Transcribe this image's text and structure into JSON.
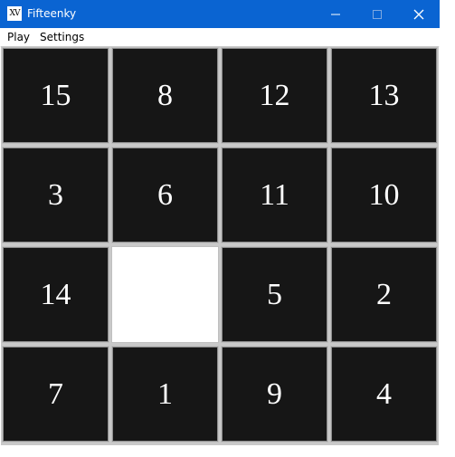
{
  "window": {
    "title": "Fifteenky",
    "icon_text": "XV",
    "titlebar_color": "#0a64d2",
    "buttons": [
      "minimize-icon",
      "maximize-icon",
      "close-icon"
    ]
  },
  "menu": {
    "play_label": "Play",
    "settings_label": "Settings"
  },
  "board": {
    "rows": 4,
    "cols": 4,
    "tiles": [
      "15",
      "8",
      "12",
      "13",
      "3",
      "6",
      "11",
      "10",
      "14",
      "",
      "5",
      "2",
      "7",
      "1",
      "9",
      "4"
    ],
    "tile_color": "#161616",
    "empty_color": "#ffffff"
  }
}
